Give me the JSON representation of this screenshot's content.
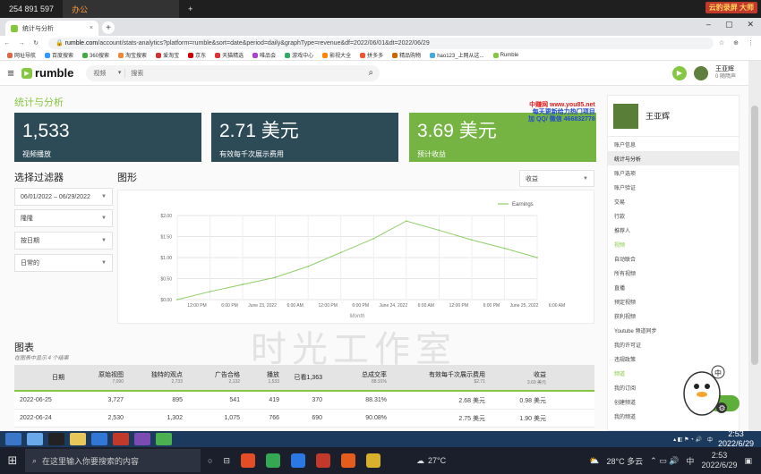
{
  "top_strip": {
    "phone": "254 891 597",
    "active_tab": "办公",
    "rec_badge": "云豹录屏 大师"
  },
  "browser": {
    "tab_title": "统计与分析",
    "url_host": "rumble.com",
    "url_path": "/account/stats-analytics?platform=rumble&sort=date&period=daily&graphType=revenue&df=2022/06/01&dt=2022/06/29",
    "bookmarks": [
      "网址导航",
      "百度搜索",
      "360搜索",
      "淘宝搜索",
      "爱淘宝",
      "京东",
      "天猫精选",
      "唯品会",
      "游戏中心",
      "影视大全",
      "拼多多",
      "精品购物",
      "hao123_上网从这...",
      "Rumble"
    ]
  },
  "header": {
    "logo": "rumble",
    "search_select": "视频",
    "search_placeholder": "搜索",
    "user_name": "王亚辉",
    "user_sub": "0 随隋声"
  },
  "page": {
    "title": "统计与分析"
  },
  "cards": [
    {
      "value": "1,533",
      "label": "视频播放"
    },
    {
      "value": "2.71 美元",
      "label": "有效每千次展示费用"
    },
    {
      "value": "3.69 美元",
      "label": "预计收益"
    }
  ],
  "ad_mark": {
    "line1": "中赚网 www.you85.net",
    "line2": "每天更新给力热门项目",
    "line3": "加 QQ/ 微信 466832778"
  },
  "filters": {
    "title": "选择过滤器",
    "items": [
      "06/01/2022 – 06/29/2022",
      "隆隆",
      "按日期",
      "日常的"
    ]
  },
  "graph": {
    "title": "图形",
    "metric_select": "收益"
  },
  "chart_data": {
    "type": "line",
    "series": [
      {
        "name": "Earnings",
        "values": [
          0.0,
          0.19,
          0.36,
          0.53,
          0.79,
          1.12,
          1.45,
          1.87,
          1.65,
          1.42,
          1.22,
          1.0
        ]
      }
    ],
    "x": [
      0,
      1,
      2,
      3,
      4,
      5,
      6,
      7,
      8,
      9,
      10,
      11
    ],
    "xtick_labels": [
      "12:00 PM",
      "6:00 PM",
      "June 23, 2022",
      "6:00 AM",
      "12:00 PM",
      "6:00 PM",
      "June 24, 2022",
      "6:00 AM",
      "12:00 PM",
      "6:00 PM",
      "June 25, 2022",
      "6:00 AM"
    ],
    "ytick_labels": [
      "$0.00",
      "$0.50",
      "$1.00",
      "$1.50",
      "$2.00"
    ],
    "xlabel": "Month",
    "ylabel": "",
    "ylim": [
      0,
      2
    ],
    "grid": true,
    "legend": "top-right",
    "color": "#8fce6a"
  },
  "table": {
    "title": "图表",
    "subtitle": "在图表中显示 4 个结果",
    "columns": [
      {
        "label": "日期",
        "sub": ""
      },
      {
        "label": "原始视图",
        "sub": "7,090"
      },
      {
        "label": "独特的观点",
        "sub": "2,733"
      },
      {
        "label": "广告合格",
        "sub": "2,132"
      },
      {
        "label": "播放",
        "sub": "1,533"
      },
      {
        "label": "已看1,363",
        "sub": ""
      },
      {
        "label": "总成交率",
        "sub": "88.91%"
      },
      {
        "label": "有效每千次展示费用",
        "sub": "$2.71"
      },
      {
        "label": "收益",
        "sub": "3.69 美元"
      }
    ],
    "rows": [
      [
        "2022-06-25",
        "3,727",
        "895",
        "541",
        "419",
        "370",
        "88.31%",
        "2.68 美元",
        "0.98 美元"
      ],
      [
        "2022-06-24",
        "2,530",
        "1,302",
        "1,075",
        "766",
        "690",
        "90.08%",
        "2.75 美元",
        "1.90 美元"
      ]
    ]
  },
  "watermark": "时光工作室",
  "sidebar": {
    "user": "王亚辉",
    "items": [
      {
        "label": "账户信息",
        "type": "item"
      },
      {
        "label": "统计与分析",
        "type": "active"
      },
      {
        "label": "账户选项",
        "type": "item"
      },
      {
        "label": "账户验证",
        "type": "item"
      },
      {
        "label": "交易",
        "type": "item"
      },
      {
        "label": "行款",
        "type": "item"
      },
      {
        "label": "推荐人",
        "type": "item"
      },
      {
        "label": "视频",
        "type": "section"
      },
      {
        "label": "自动联合",
        "type": "item"
      },
      {
        "label": "所有视频",
        "type": "item"
      },
      {
        "label": "直播",
        "type": "item"
      },
      {
        "label": "预定视频",
        "type": "item"
      },
      {
        "label": "获利视频",
        "type": "item"
      },
      {
        "label": "Youtube 频道同步",
        "type": "item"
      },
      {
        "label": "我的许可证",
        "type": "item"
      },
      {
        "label": "违规政策",
        "type": "item"
      },
      {
        "label": "频道",
        "type": "section"
      },
      {
        "label": "我的订阅",
        "type": "item"
      },
      {
        "label": "创建频道",
        "type": "item"
      },
      {
        "label": "我的频道",
        "type": "item"
      }
    ]
  },
  "taskbar": {
    "search_placeholder": "在这里输入你要搜索的内容",
    "weather1": "27°C",
    "weather2": "28°C 多云",
    "ime": "中",
    "time": "2:53",
    "date": "2022/6/29",
    "tray_time": "2:53",
    "tray_date": "2022/6/29"
  }
}
